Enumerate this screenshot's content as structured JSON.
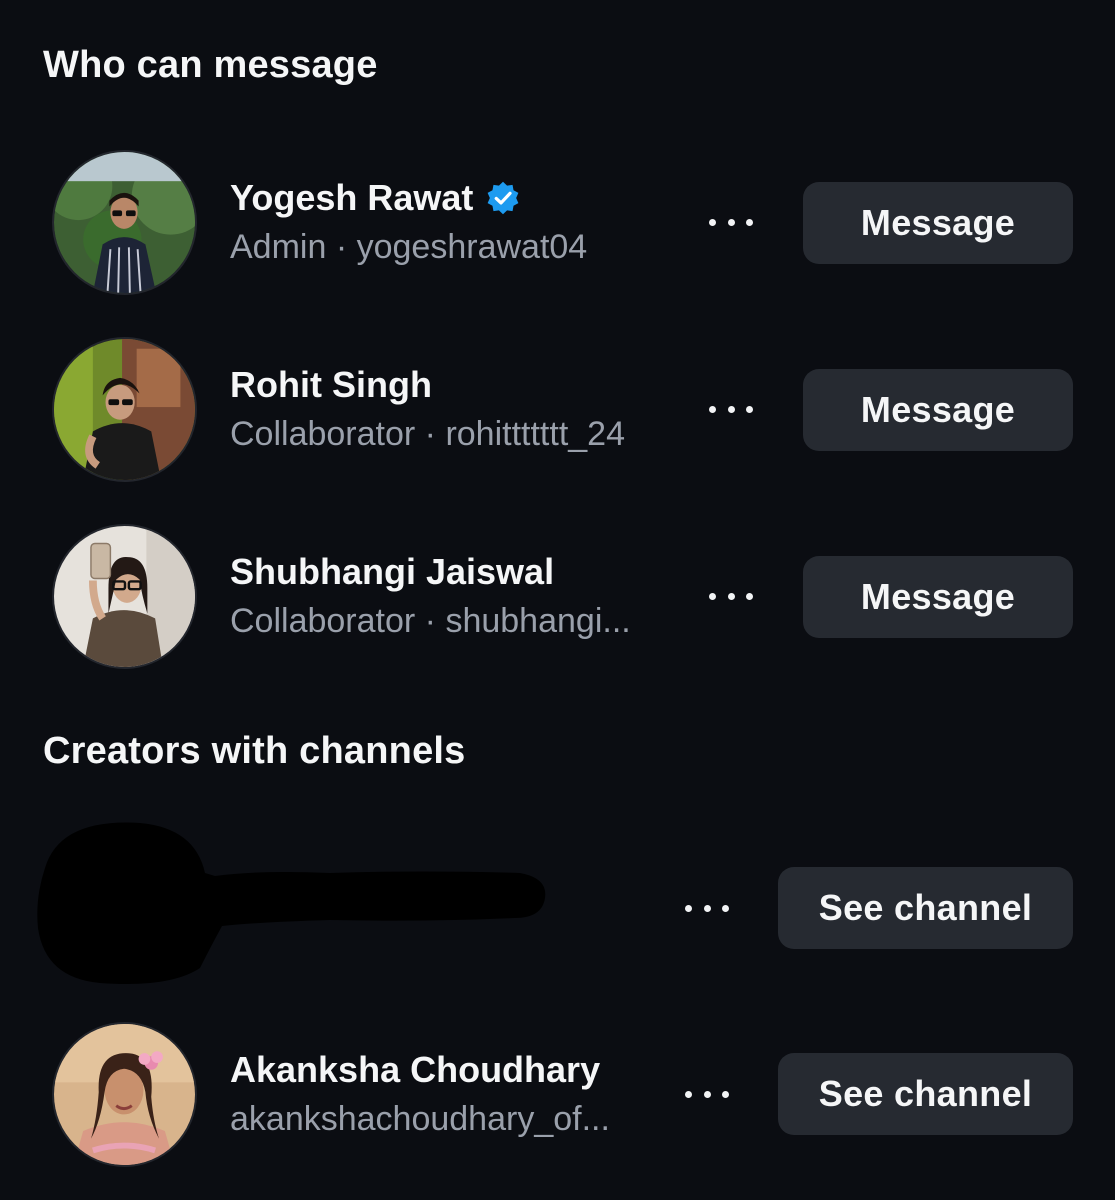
{
  "sections": {
    "who_can_message": {
      "title": "Who can message",
      "members": [
        {
          "name": "Yogesh Rawat",
          "verified": true,
          "role": "Admin",
          "separator": "·",
          "handle": "yogeshrawat04",
          "action_label": "Message"
        },
        {
          "name": "Rohit Singh",
          "verified": false,
          "role": "Collaborator",
          "separator": "·",
          "handle": "rohittttttt_24",
          "action_label": "Message"
        },
        {
          "name": "Shubhangi Jaiswal",
          "verified": false,
          "role": "Collaborator",
          "separator": "·",
          "handle": "shubhangi...",
          "action_label": "Message"
        }
      ]
    },
    "creators_with_channels": {
      "title": "Creators with channels",
      "creators": [
        {
          "name": "",
          "redacted": true,
          "action_label": "See channel"
        },
        {
          "name": "Akanksha Choudhary",
          "handle": "akankshachoudhary_of...",
          "action_label": "See channel"
        }
      ]
    }
  },
  "colors": {
    "background": "#0b0d12",
    "button_bg": "#262a31",
    "verified_blue": "#1d9bf0",
    "secondary_text": "#9aa0ab"
  },
  "icons": {
    "verified": "verified-badge-icon",
    "more": "more-horizontal-icon"
  }
}
